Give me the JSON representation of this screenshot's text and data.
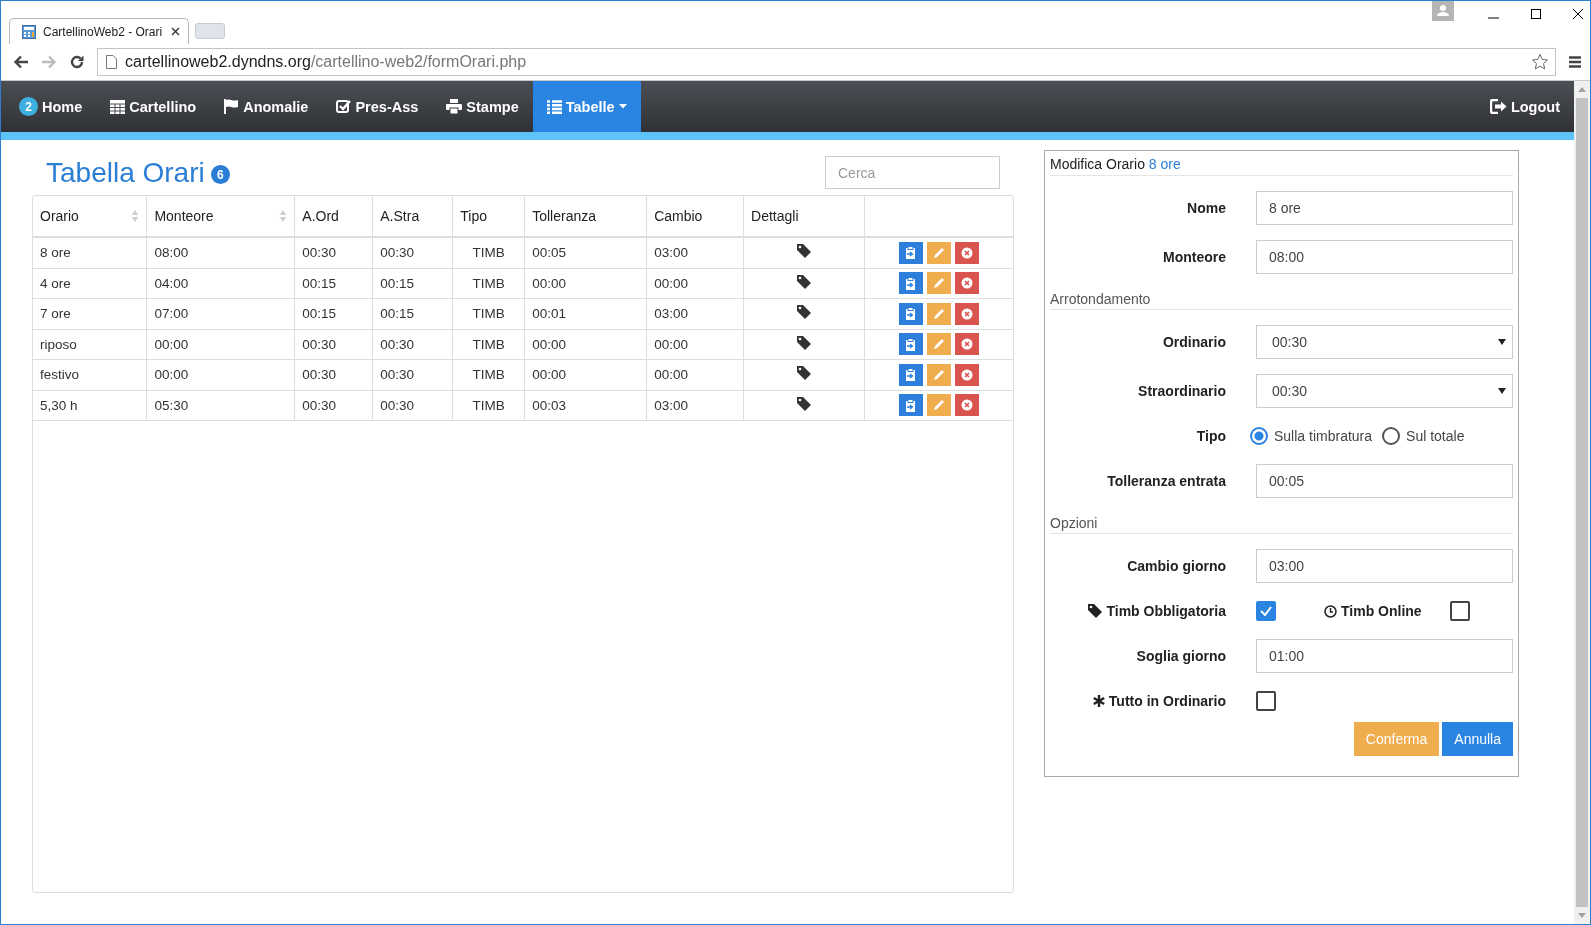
{
  "browser": {
    "tab_title": "CartellinoWeb2 - Orari",
    "url_host": "cartellinoweb2.dyndns.org",
    "url_path": "/cartellino-web2/formOrari.php"
  },
  "nav": {
    "items": [
      {
        "label": "Home",
        "badge": "2",
        "selected": false
      },
      {
        "label": "Cartellino",
        "selected": false
      },
      {
        "label": "Anomalie",
        "selected": false
      },
      {
        "label": "Pres-Ass",
        "selected": false
      },
      {
        "label": "Stampe",
        "selected": false
      },
      {
        "label": "Tabelle",
        "selected": true,
        "dropdown": true
      }
    ],
    "logout": "Logout"
  },
  "page": {
    "title": "Tabella Orari",
    "count": "6",
    "search": {
      "placeholder": "Cerca"
    }
  },
  "table": {
    "columns": [
      {
        "label": "Orario",
        "sortable": true
      },
      {
        "label": "Monteore",
        "sortable": true
      },
      {
        "label": "A.Ord",
        "sortable": false
      },
      {
        "label": "A.Stra",
        "sortable": false
      },
      {
        "label": "Tipo",
        "sortable": false
      },
      {
        "label": "Tolleranza",
        "sortable": false
      },
      {
        "label": "Cambio",
        "sortable": false
      },
      {
        "label": "Dettagli",
        "sortable": false
      }
    ],
    "rows": [
      [
        "8 ore",
        "08:00",
        "00:30",
        "00:30",
        "TIMB",
        "00:05",
        "03:00"
      ],
      [
        "4 ore",
        "04:00",
        "00:15",
        "00:15",
        "TIMB",
        "00:00",
        "00:00"
      ],
      [
        "7 ore",
        "07:00",
        "00:15",
        "00:15",
        "TIMB",
        "00:01",
        "03:00"
      ],
      [
        "riposo",
        "00:00",
        "00:30",
        "00:30",
        "TIMB",
        "00:00",
        "00:00"
      ],
      [
        "festivo",
        "00:00",
        "00:30",
        "00:30",
        "TIMB",
        "00:00",
        "00:00"
      ],
      [
        "5,30 h",
        "05:30",
        "00:30",
        "00:30",
        "TIMB",
        "00:03",
        "03:00"
      ]
    ]
  },
  "form": {
    "heading": "Modifica Orario",
    "heading_name": "8 ore",
    "rows": [
      {
        "kind": "text",
        "label": "Nome",
        "value": "8 ore"
      },
      {
        "kind": "text",
        "label": "Monteore",
        "value": "08:00"
      },
      {
        "kind": "section",
        "label": "Arrotondamento"
      },
      {
        "kind": "select",
        "label": "Ordinario",
        "value": "00:30"
      },
      {
        "kind": "select",
        "label": "Straordinario",
        "value": "00:30"
      },
      {
        "kind": "radio",
        "label": "Tipo",
        "options": [
          {
            "label": "Sulla timbratura",
            "selected": true
          },
          {
            "label": "Sul totale",
            "selected": false
          }
        ]
      },
      {
        "kind": "text",
        "label": "Tolleranza entrata",
        "value": "00:05"
      },
      {
        "kind": "section",
        "label": "Opzioni"
      },
      {
        "kind": "text",
        "label": "Cambio giorno",
        "value": "03:00"
      },
      {
        "kind": "checks",
        "items": [
          {
            "label": "Timb Obbligatoria",
            "checked": true
          },
          {
            "label": "Timb Online",
            "checked": false
          }
        ]
      },
      {
        "kind": "text",
        "label": "Soglia giorno",
        "value": "01:00"
      },
      {
        "kind": "checks",
        "items": [
          {
            "label": "Tutto in Ordinario",
            "checked": false
          }
        ]
      }
    ],
    "buttons": [
      {
        "label": "Conferma",
        "kind": "warning"
      },
      {
        "label": "Annulla",
        "kind": "primary"
      }
    ]
  }
}
